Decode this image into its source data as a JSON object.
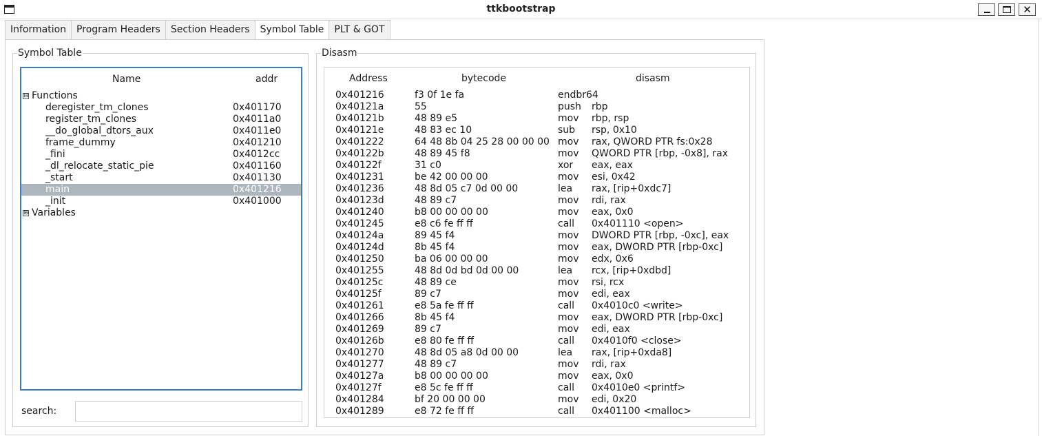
{
  "window": {
    "title": "ttkbootstrap",
    "minimize_label": "",
    "maximize_label": "",
    "close_label": "✕"
  },
  "tabs": [
    {
      "label": "Information",
      "active": false
    },
    {
      "label": "Program Headers",
      "active": false
    },
    {
      "label": "Section Headers",
      "active": false
    },
    {
      "label": "Symbol Table",
      "active": true
    },
    {
      "label": "PLT & GOT",
      "active": false
    }
  ],
  "symbol_table": {
    "frame_label": "Symbol Table",
    "columns": {
      "name": "Name",
      "addr": "addr"
    },
    "groups": [
      {
        "label": "Functions",
        "expanded": true,
        "expander": "⊟",
        "items": [
          {
            "name": "deregister_tm_clones",
            "addr": "0x401170",
            "selected": false
          },
          {
            "name": "register_tm_clones",
            "addr": "0x4011a0",
            "selected": false
          },
          {
            "name": "__do_global_dtors_aux",
            "addr": "0x4011e0",
            "selected": false
          },
          {
            "name": "frame_dummy",
            "addr": "0x401210",
            "selected": false
          },
          {
            "name": "_fini",
            "addr": "0x4012cc",
            "selected": false
          },
          {
            "name": "_dl_relocate_static_pie",
            "addr": "0x401160",
            "selected": false
          },
          {
            "name": "_start",
            "addr": "0x401130",
            "selected": false
          },
          {
            "name": "main",
            "addr": "0x401216",
            "selected": true
          },
          {
            "name": "_init",
            "addr": "0x401000",
            "selected": false
          }
        ]
      },
      {
        "label": "Variables",
        "expanded": false,
        "expander": "⊞",
        "items": []
      }
    ],
    "search_label": "search:",
    "search_value": "",
    "search_placeholder": ""
  },
  "disasm": {
    "frame_label": "Disasm",
    "columns": {
      "address": "Address",
      "bytecode": "bytecode",
      "disasm": "disasm"
    },
    "rows": [
      {
        "address": "0x401216",
        "bytecode": "f3 0f 1e fa",
        "mnemonic": "endbr64",
        "operands": ""
      },
      {
        "address": "0x40121a",
        "bytecode": "55",
        "mnemonic": "push",
        "operands": "rbp"
      },
      {
        "address": "0x40121b",
        "bytecode": "48 89 e5",
        "mnemonic": "mov",
        "operands": "rbp, rsp"
      },
      {
        "address": "0x40121e",
        "bytecode": "48 83 ec 10",
        "mnemonic": "sub",
        "operands": "rsp, 0x10"
      },
      {
        "address": "0x401222",
        "bytecode": "64 48 8b 04 25 28 00 00 00",
        "mnemonic": "mov",
        "operands": "rax, QWORD PTR fs:0x28"
      },
      {
        "address": "0x40122b",
        "bytecode": "48 89 45 f8",
        "mnemonic": "mov",
        "operands": "QWORD PTR [rbp, -0x8], rax"
      },
      {
        "address": "0x40122f",
        "bytecode": "31 c0",
        "mnemonic": "xor",
        "operands": "eax, eax"
      },
      {
        "address": "0x401231",
        "bytecode": "be 42 00 00 00",
        "mnemonic": "mov",
        "operands": "esi, 0x42"
      },
      {
        "address": "0x401236",
        "bytecode": "48 8d 05 c7 0d 00 00",
        "mnemonic": "lea",
        "operands": "rax, [rip+0xdc7]"
      },
      {
        "address": "0x40123d",
        "bytecode": "48 89 c7",
        "mnemonic": "mov",
        "operands": "rdi, rax"
      },
      {
        "address": "0x401240",
        "bytecode": "b8 00 00 00 00",
        "mnemonic": "mov",
        "operands": "eax, 0x0"
      },
      {
        "address": "0x401245",
        "bytecode": "e8 c6 fe ff ff",
        "mnemonic": "call",
        "operands": "0x401110 <open>"
      },
      {
        "address": "0x40124a",
        "bytecode": "89 45 f4",
        "mnemonic": "mov",
        "operands": "DWORD PTR [rbp, -0xc], eax"
      },
      {
        "address": "0x40124d",
        "bytecode": "8b 45 f4",
        "mnemonic": "mov",
        "operands": "eax, DWORD PTR [rbp-0xc]"
      },
      {
        "address": "0x401250",
        "bytecode": "ba 06 00 00 00",
        "mnemonic": "mov",
        "operands": "edx, 0x6"
      },
      {
        "address": "0x401255",
        "bytecode": "48 8d 0d bd 0d 00 00",
        "mnemonic": "lea",
        "operands": "rcx, [rip+0xdbd]"
      },
      {
        "address": "0x40125c",
        "bytecode": "48 89 ce",
        "mnemonic": "mov",
        "operands": "rsi, rcx"
      },
      {
        "address": "0x40125f",
        "bytecode": "89 c7",
        "mnemonic": "mov",
        "operands": "edi, eax"
      },
      {
        "address": "0x401261",
        "bytecode": "e8 5a fe ff ff",
        "mnemonic": "call",
        "operands": "0x4010c0 <write>"
      },
      {
        "address": "0x401266",
        "bytecode": "8b 45 f4",
        "mnemonic": "mov",
        "operands": "eax, DWORD PTR [rbp-0xc]"
      },
      {
        "address": "0x401269",
        "bytecode": "89 c7",
        "mnemonic": "mov",
        "operands": "edi, eax"
      },
      {
        "address": "0x40126b",
        "bytecode": "e8 80 fe ff ff",
        "mnemonic": "call",
        "operands": "0x4010f0 <close>"
      },
      {
        "address": "0x401270",
        "bytecode": "48 8d 05 a8 0d 00 00",
        "mnemonic": "lea",
        "operands": "rax, [rip+0xda8]"
      },
      {
        "address": "0x401277",
        "bytecode": "48 89 c7",
        "mnemonic": "mov",
        "operands": "rdi, rax"
      },
      {
        "address": "0x40127a",
        "bytecode": "b8 00 00 00 00",
        "mnemonic": "mov",
        "operands": "eax, 0x0"
      },
      {
        "address": "0x40127f",
        "bytecode": "e8 5c fe ff ff",
        "mnemonic": "call",
        "operands": "0x4010e0 <printf>"
      },
      {
        "address": "0x401284",
        "bytecode": "bf 20 00 00 00",
        "mnemonic": "mov",
        "operands": "edi, 0x20"
      },
      {
        "address": "0x401289",
        "bytecode": "e8 72 fe ff ff",
        "mnemonic": "call",
        "operands": "0x401100 <malloc>"
      }
    ]
  },
  "colors": {
    "accent": "#3c7ac8",
    "selection": "#adb5bd",
    "border": "#cfcfcf"
  }
}
